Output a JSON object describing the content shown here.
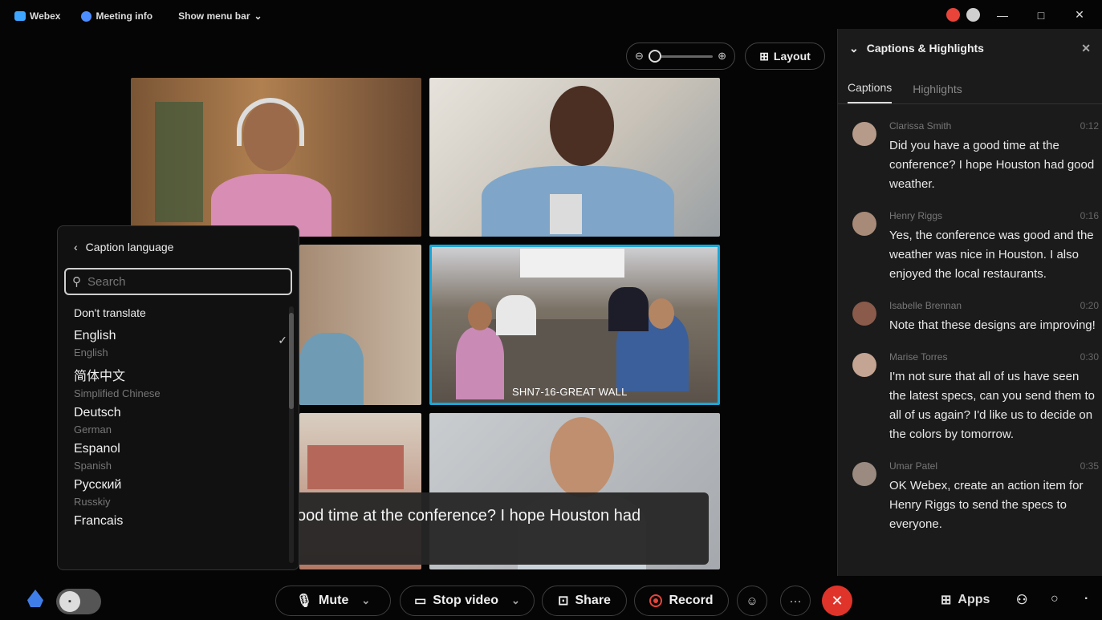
{
  "titlebar": {
    "app_name": "Webex",
    "meeting_info": "Meeting info",
    "show_menu_bar": "Show menu bar",
    "minimize": "—",
    "maximize": "□",
    "close": "✕"
  },
  "view": {
    "layout_label": "Layout"
  },
  "video": {
    "room_label": "SHN7-16-GREAT WALL"
  },
  "caption_language": {
    "title": "Caption language",
    "search_placeholder": "Search",
    "dont_translate": "Don't translate",
    "languages": [
      {
        "name": "English",
        "sub": "English",
        "selected": true
      },
      {
        "name": "简体中文",
        "sub": "Simplified Chinese",
        "selected": false
      },
      {
        "name": "Deutsch",
        "sub": "German",
        "selected": false
      },
      {
        "name": "Espanol",
        "sub": "Spanish",
        "selected": false
      },
      {
        "name": "Русский",
        "sub": "Russkiy",
        "selected": false
      },
      {
        "name": "Francais",
        "sub": "",
        "selected": false
      }
    ]
  },
  "live_caption": {
    "text": "ood time at the conference? I hope Houston had"
  },
  "sidebar": {
    "title": "Captions & Highlights",
    "tabs": [
      {
        "label": "Captions",
        "active": true
      },
      {
        "label": "Highlights",
        "active": false
      }
    ],
    "messages": [
      {
        "name": "Clarissa Smith",
        "time": "0:12",
        "text": "Did you have a good time at the conference? I hope Houston had good weather."
      },
      {
        "name": "Henry Riggs",
        "time": "0:16",
        "text": "Yes, the conference was good and the weather was nice in Houston. I also enjoyed the local restaurants."
      },
      {
        "name": "Isabelle Brennan",
        "time": "0:20",
        "text": "Note that these designs are improving!"
      },
      {
        "name": "Marise Torres",
        "time": "0:30",
        "text": "I'm not sure that all of us have seen the latest specs, can you send them to all of us again? I'd like us to decide on the colors by tomorrow."
      },
      {
        "name": "Umar Patel",
        "time": "0:35",
        "text": "OK Webex, create an action item for Henry Riggs to send the specs to everyone."
      }
    ]
  },
  "controls": {
    "mute": "Mute",
    "stop_video": "Stop video",
    "share": "Share",
    "record": "Record",
    "apps": "Apps"
  },
  "colors": {
    "accent_blue": "#1aa7d8",
    "end_call_red": "#e0342b",
    "recording_red": "#e8443a"
  }
}
